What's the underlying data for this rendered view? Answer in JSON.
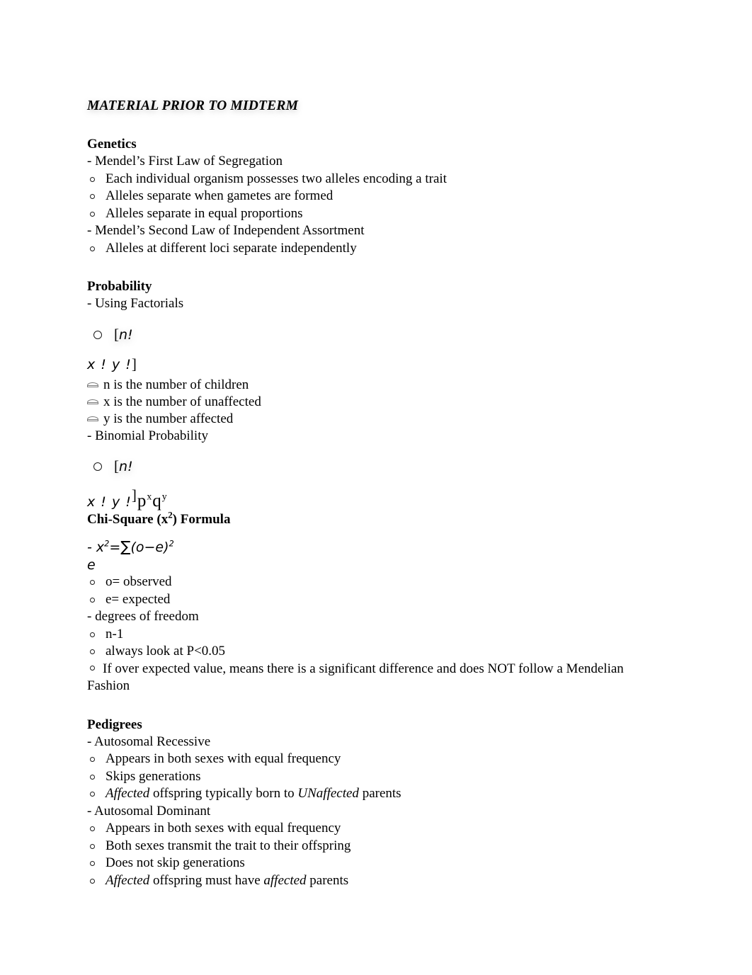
{
  "document": {
    "title": "MATERIAL PRIOR TO MIDTERM"
  },
  "sections": {
    "genetics": {
      "heading": "Genetics",
      "law1": "- Mendel’s First Law of Segregation",
      "law1_points": [
        "Each individual organism possesses two alleles encoding a trait",
        "Alleles separate when gametes are formed",
        "Alleles separate in equal proportions"
      ],
      "law2": "- Mendel’s Second Law of Independent Assortment",
      "law2_points": [
        "Alleles at different loci separate independently"
      ]
    },
    "probability": {
      "heading": "Probability",
      "item1": "- Using Factorials",
      "factorial_formula": {
        "numerator": "n!",
        "bracket_open": "[",
        "denominator": "x ! y !",
        "bracket_close": "]"
      },
      "definitions": [
        "n is the number of children",
        "x is the number of unaffected",
        "y is the number affected"
      ],
      "item2": "- Binomial Probability",
      "binomial_formula": {
        "numerator": "n!",
        "bracket_open": "[",
        "denominator": "x ! y !",
        "bracket_close": "]",
        "factor_p": "p",
        "factor_p_exp": "x",
        "factor_q": "q",
        "factor_q_exp": "y"
      }
    },
    "chi_square": {
      "heading_prefix": "Chi-Square (x",
      "heading_sup": "2",
      "heading_suffix": ") Formula",
      "formula_line": "- x",
      "formula_sup1": "2",
      "formula_mid": "=",
      "formula_sigma": "∑",
      "formula_expr": "(o−e)",
      "formula_sup2": "2",
      "formula_denominator": "e",
      "definitions": [
        "o= observed",
        "e= expected"
      ],
      "dof_label": "- degrees of freedom",
      "dof_points": [
        "n-1",
        "always look at P<0.05"
      ],
      "note_prefix": "If over expected value, means there is a significant difference and does NOT follow a Mendelian Fashion"
    },
    "pedigrees": {
      "heading": "Pedigrees",
      "recessive": {
        "label": "- Autosomal Recessive",
        "points": [
          {
            "plain": "Appears in both sexes with equal frequency"
          },
          {
            "plain": "Skips generations"
          },
          {
            "italic1": "Affected",
            "mid": " offspring typically born to ",
            "italic2": "UNaffected",
            "tail": " parents"
          }
        ]
      },
      "dominant": {
        "label": "- Autosomal Dominant",
        "points": [
          {
            "plain": "Appears in both sexes with equal frequency"
          },
          {
            "plain": "Both sexes transmit the trait to their offspring"
          },
          {
            "plain": "Does not skip generations"
          },
          {
            "italic1": "Affected",
            "mid": " offspring must have ",
            "italic2": "affected",
            "tail": " parents"
          }
        ]
      }
    }
  }
}
